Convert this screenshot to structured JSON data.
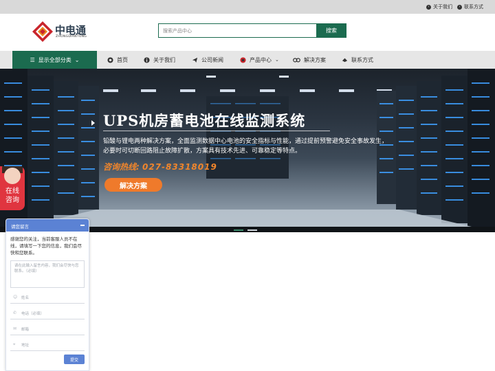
{
  "topbar": {
    "links": [
      {
        "label": "关于我们",
        "icon": "circle-arrow-icon"
      },
      {
        "label": "联系方式",
        "icon": "circle-arrow-icon"
      }
    ]
  },
  "header": {
    "logo": {
      "name": "中电通",
      "sub": "ZHONGDIANTONG",
      "colors": [
        "#c9252c",
        "#e88c1f"
      ]
    },
    "search": {
      "placeholder": "搜索产品中心",
      "button": "搜索"
    }
  },
  "nav": {
    "category_button": "显示全部分类",
    "items": [
      {
        "label": "首页",
        "icon": "home-icon"
      },
      {
        "label": "关于我们",
        "icon": "info-icon"
      },
      {
        "label": "公司新闻",
        "icon": "news-icon"
      },
      {
        "label": "产品中心",
        "icon": "product-icon",
        "has_dropdown": true
      },
      {
        "label": "解决方案",
        "icon": "solution-icon"
      },
      {
        "label": "联系方式",
        "icon": "contact-icon"
      }
    ]
  },
  "banner": {
    "title": "UPS机房蓄电池在线监测系统",
    "description": "铅酸与锂电两种解决方案，全面监测数据中心电池的安全指标与性能，通过提前预警避免安全事故发生，必要时可切断回路阻止故障扩散，方案具有技术先进、可靠稳定等特点。",
    "hotline_label": "咨询热线:",
    "hotline_number": "027-83318019",
    "button": "解决方案",
    "slides": 2,
    "active_slide": 0
  },
  "consult": {
    "line1": "在线",
    "line2": "咨询"
  },
  "message_panel": {
    "title": "请您留言",
    "intro": "感谢您的关注，当前客服人员不在线，请填写一下您的信息，我们会尽快和您联系。",
    "textarea_placeholder": "请在此输入留言内容，我们会尽快与您联系。（必填）",
    "fields": [
      {
        "placeholder": "姓名",
        "icon": "person-icon"
      },
      {
        "placeholder": "电话（必填）",
        "icon": "phone-icon"
      },
      {
        "placeholder": "邮箱",
        "icon": "mail-icon"
      },
      {
        "placeholder": "地址",
        "icon": "location-icon"
      }
    ],
    "submit": "提交"
  },
  "colors": {
    "brand_green": "#1b6b4f",
    "accent_orange": "#ef7a2b",
    "panel_blue": "#5b82d4",
    "consult_red": "#e0353f"
  }
}
